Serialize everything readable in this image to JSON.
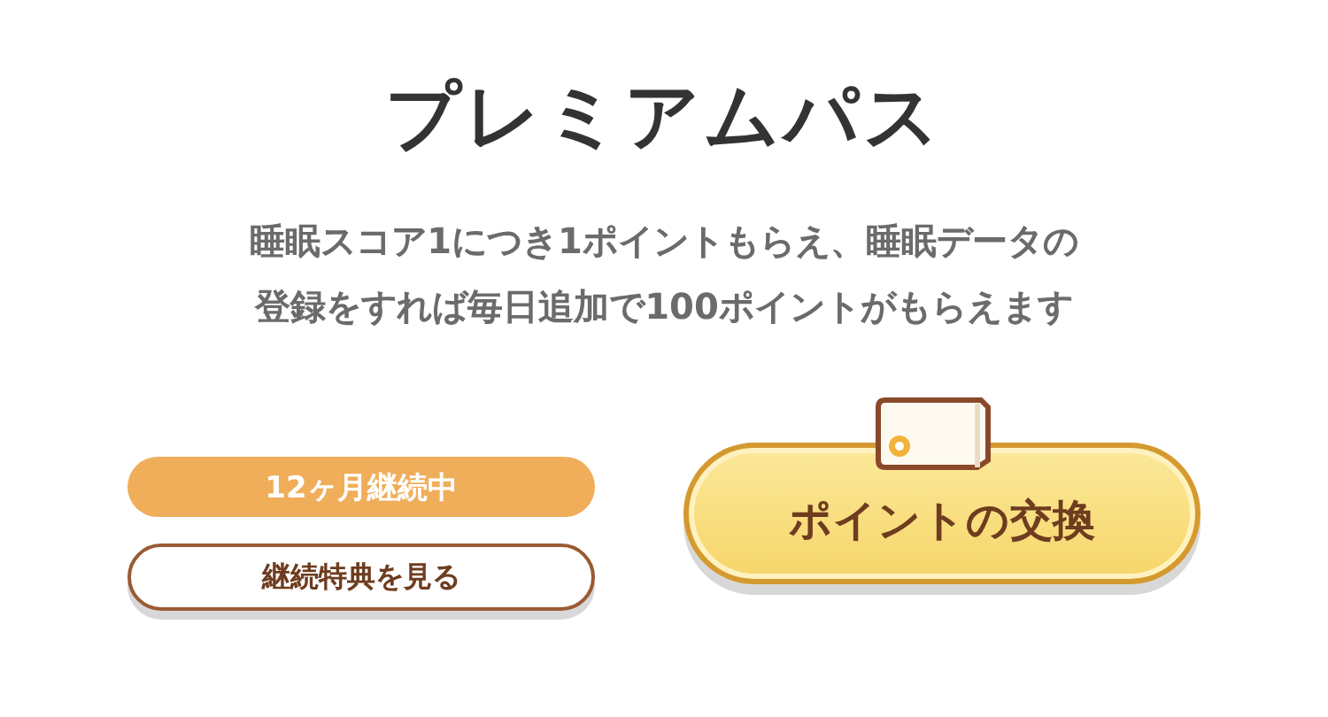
{
  "title": "プレミアムパス",
  "description": [
    "睡眠スコア1につき1ポイントもらえ、睡眠データの",
    "登録をすれば毎日追加で100ポイントがもらえます"
  ],
  "streak_badge": "12ヶ月継続中",
  "benefits_button": "継続特典を見る",
  "exchange_button": "ポイントの交換"
}
